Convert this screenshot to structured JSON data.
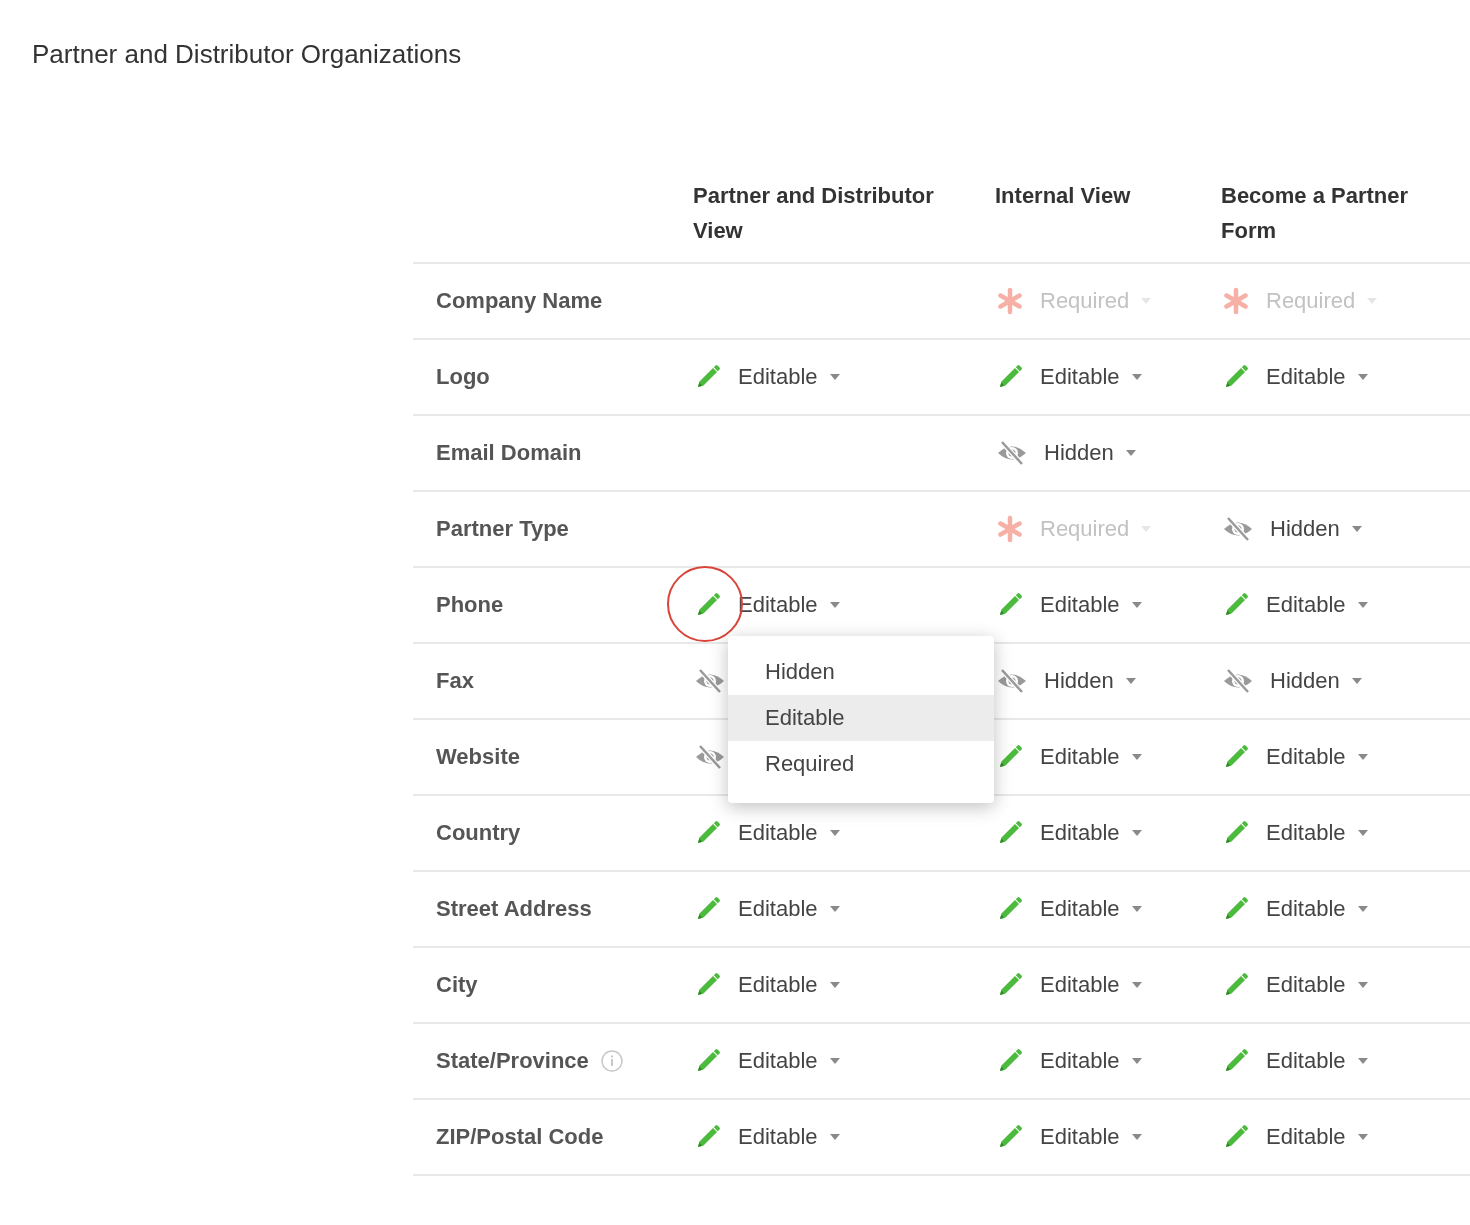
{
  "page_title": "Partner and Distributor Organizations",
  "columns": [
    "Partner and Distributor View",
    "Internal View",
    "Become a Partner Form"
  ],
  "rows": [
    {
      "label": "Company Name",
      "info": false,
      "cells": [
        null,
        {
          "kind": "required",
          "label": "Required",
          "disabled": true
        },
        {
          "kind": "required",
          "label": "Required",
          "disabled": true
        }
      ]
    },
    {
      "label": "Logo",
      "info": false,
      "cells": [
        {
          "kind": "editable",
          "label": "Editable",
          "disabled": false
        },
        {
          "kind": "editable",
          "label": "Editable",
          "disabled": false
        },
        {
          "kind": "editable",
          "label": "Editable",
          "disabled": false
        }
      ]
    },
    {
      "label": "Email Domain",
      "info": false,
      "cells": [
        null,
        {
          "kind": "hidden",
          "label": "Hidden",
          "disabled": false
        },
        null
      ]
    },
    {
      "label": "Partner Type",
      "info": false,
      "cells": [
        null,
        {
          "kind": "required",
          "label": "Required",
          "disabled": true
        },
        {
          "kind": "hidden",
          "label": "Hidden",
          "disabled": false
        }
      ]
    },
    {
      "label": "Phone",
      "info": false,
      "cells": [
        {
          "kind": "editable",
          "label": "Editable",
          "disabled": false,
          "annotated": true,
          "menu": [
            {
              "label": "Hidden",
              "selected": false
            },
            {
              "label": "Editable",
              "selected": true
            },
            {
              "label": "Required",
              "selected": false
            }
          ]
        },
        {
          "kind": "editable",
          "label": "Editable",
          "disabled": false
        },
        {
          "kind": "editable",
          "label": "Editable",
          "disabled": false
        }
      ]
    },
    {
      "label": "Fax",
      "info": false,
      "cells": [
        {
          "kind": "hidden",
          "disabled": false
        },
        {
          "kind": "hidden",
          "label": "Hidden",
          "disabled": false
        },
        {
          "kind": "hidden",
          "label": "Hidden",
          "disabled": false
        }
      ]
    },
    {
      "label": "Website",
      "info": false,
      "cells": [
        {
          "kind": "hidden",
          "disabled": false
        },
        {
          "kind": "editable",
          "label": "Editable",
          "disabled": false
        },
        {
          "kind": "editable",
          "label": "Editable",
          "disabled": false
        }
      ]
    },
    {
      "label": "Country",
      "info": false,
      "cells": [
        {
          "kind": "editable",
          "label": "Editable",
          "disabled": false
        },
        {
          "kind": "editable",
          "label": "Editable",
          "disabled": false
        },
        {
          "kind": "editable",
          "label": "Editable",
          "disabled": false
        }
      ]
    },
    {
      "label": "Street Address",
      "info": false,
      "cells": [
        {
          "kind": "editable",
          "label": "Editable",
          "disabled": false
        },
        {
          "kind": "editable",
          "label": "Editable",
          "disabled": false
        },
        {
          "kind": "editable",
          "label": "Editable",
          "disabled": false
        }
      ]
    },
    {
      "label": "City",
      "info": false,
      "cells": [
        {
          "kind": "editable",
          "label": "Editable",
          "disabled": false
        },
        {
          "kind": "editable",
          "label": "Editable",
          "disabled": false
        },
        {
          "kind": "editable",
          "label": "Editable",
          "disabled": false
        }
      ]
    },
    {
      "label": "State/Province",
      "info": true,
      "cells": [
        {
          "kind": "editable",
          "label": "Editable",
          "disabled": false
        },
        {
          "kind": "editable",
          "label": "Editable",
          "disabled": false
        },
        {
          "kind": "editable",
          "label": "Editable",
          "disabled": false
        }
      ]
    },
    {
      "label": "ZIP/Postal Code",
      "info": false,
      "cells": [
        {
          "kind": "editable",
          "label": "Editable",
          "disabled": false
        },
        {
          "kind": "editable",
          "label": "Editable",
          "disabled": false
        },
        {
          "kind": "editable",
          "label": "Editable",
          "disabled": false
        }
      ]
    }
  ]
}
